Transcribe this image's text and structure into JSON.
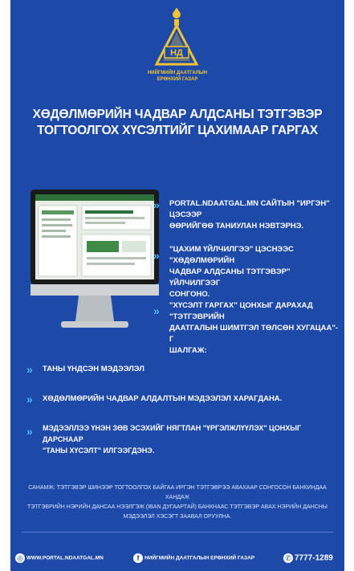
{
  "organization": {
    "name_line1": "НИЙГМИЙН ДААТГАЛЫН",
    "name_line2": "ЕРӨНХИЙ ГАЗАР",
    "logo_text": "НД"
  },
  "title": {
    "line1": "ХӨДӨЛМӨРИЙН ЧАДВАР АЛДСАНЫ ТЭТГЭВЭР",
    "line2": "ТОГТООЛГОХ ХҮСЭЛТИЙГ ЦАХИМААР ГАРГАХ"
  },
  "steps": [
    {
      "line1": "PORTAL.NDAATGAL.MN САЙТЫН \"ИРГЭН\" ЦЭСЭЭР",
      "line2": "ӨӨРИЙГӨӨ ТАНИУЛАН НЭВТЭРНЭ.",
      "line3": ""
    },
    {
      "line1": "\"ЦАХИМ ҮЙЛЧИЛГЭЭ\" ЦЭСНЭЭС \"ХӨДӨЛМӨРИЙН",
      "line2": "ЧАДВАР АЛДСАНЫ ТЭТГЭВЭР\" ҮЙЛЧИЛГЭЭГ",
      "line3": "СОНГОНО."
    },
    {
      "line1": "\"ХҮСЭЛТ ГАРГАХ\" ЦОНХЫГ ДАРАХАД \"ТЭТГЭВРИЙН",
      "line2": "ДААТГАЛЫН ШИМТГЭЛ ТӨЛСӨН ХУГАЦАА\"-Г",
      "line3": "ШАЛГАЖ:"
    },
    {
      "line1": "ТАНЫ ҮНДСЭН МЭДЭЭЛЭЛ",
      "line2": "",
      "line3": ""
    },
    {
      "line1": "ХӨДӨЛМӨРИЙН ЧАДВАР АЛДАЛТЫН МЭДЭЭЛЭЛ ХАРАГДАНА.",
      "line2": "",
      "line3": ""
    },
    {
      "line1": "МЭДЭЭЛЛЭЭ ҮНЭН ЗӨВ ЭСЭХИЙГ НЯГТЛАН \"ҮРГЭЛЖЛҮҮЛЭХ\" ЦОНХЫГ ДАРСНААР",
      "line2": "\"ТАНЫ ХҮСЭЛТ\" ИЛГЭЭГДЭНЭ.",
      "line3": ""
    }
  ],
  "bullet_glyph": "»",
  "note": {
    "line1": "САНАМЖ: ТЭТГЭВЭР ШИНЭЭР ТОГТООЛГОХ БАЙГАА ИРГЭН ТЭТГЭВРЭЭ АВАХААР СОНГОСОН БАНКИНДАА ХАНДАЖ",
    "line2": "ТЭТГЭВРИЙН НЭРИЙН ДАНСАА НЭЭЛГЭЖ (IBAN ДУГААРТАЙ) БАНКНААС ТЭТГЭВЭР АВАХ НЭРИЙН ДАНСНЫ",
    "line3": "МЭДЭЭЛЭЛ ХЭСЭГТ ЗААВАЛ ОРУУЛНА."
  },
  "footer": {
    "website": "WWW.PORTAL.NDAATGAL.MN",
    "facebook": "НИЙГМИЙН ДААТГАЛЫН ЕРӨНХИЙ ГАЗАР",
    "phone": "7777-1289"
  },
  "colors": {
    "background": "#1d4aa8",
    "accent": "#4fb8ff",
    "gold": "#f2c230"
  },
  "icons": {
    "website": "globe-icon",
    "facebook": "facebook-icon",
    "phone": "phone-icon"
  }
}
